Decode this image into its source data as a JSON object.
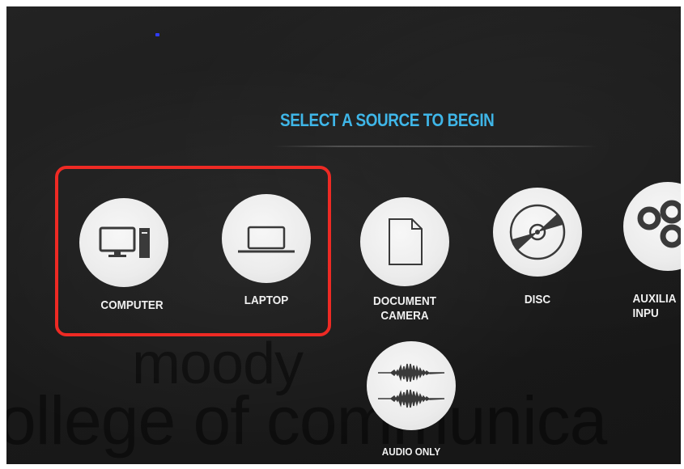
{
  "header": {
    "title": "SELECT A SOURCE TO BEGIN"
  },
  "sources": [
    {
      "label": "COMPUTER",
      "icon": "computer-icon"
    },
    {
      "label": "LAPTOP",
      "icon": "laptop-icon"
    },
    {
      "label": "DOCUMENT\nCAMERA",
      "icon": "document-icon"
    },
    {
      "label": "DISC",
      "icon": "disc-icon"
    },
    {
      "label": "AUXILIA\nINPU",
      "icon": "auxiliary-input-icon"
    },
    {
      "label": "AUDIO ONLY",
      "icon": "audio-waveform-icon"
    }
  ],
  "watermark": {
    "line1": "moody",
    "line2": "ollege of communica"
  },
  "colors": {
    "accent": "#3fb6e8",
    "highlight": "#ee2a24",
    "background": "#1c1c1c"
  }
}
